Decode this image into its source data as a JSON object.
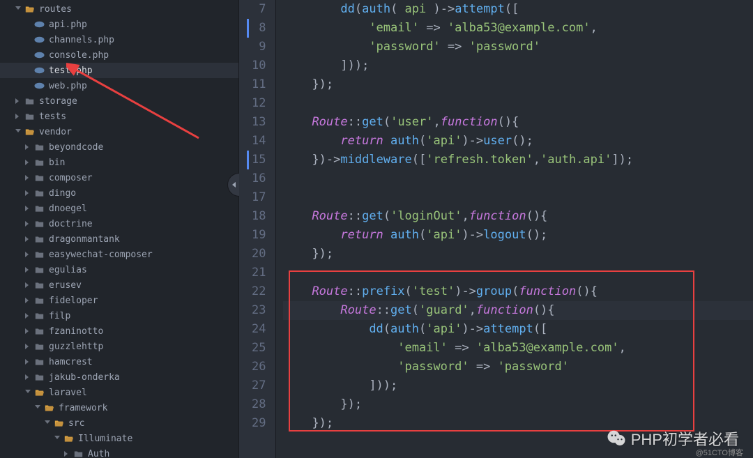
{
  "sidebar": {
    "items": [
      {
        "indent": 1,
        "kind": "folder-open",
        "arrow": "expanded",
        "label": "routes"
      },
      {
        "indent": 2,
        "kind": "php",
        "arrow": "",
        "label": "api.php"
      },
      {
        "indent": 2,
        "kind": "php",
        "arrow": "",
        "label": "channels.php"
      },
      {
        "indent": 2,
        "kind": "php",
        "arrow": "",
        "label": "console.php"
      },
      {
        "indent": 2,
        "kind": "php",
        "arrow": "",
        "label": "test.php",
        "active": true
      },
      {
        "indent": 2,
        "kind": "php",
        "arrow": "",
        "label": "web.php"
      },
      {
        "indent": 1,
        "kind": "folder",
        "arrow": "collapsed",
        "label": "storage"
      },
      {
        "indent": 1,
        "kind": "folder",
        "arrow": "collapsed",
        "label": "tests"
      },
      {
        "indent": 1,
        "kind": "folder-open",
        "arrow": "expanded",
        "label": "vendor"
      },
      {
        "indent": 2,
        "kind": "folder",
        "arrow": "collapsed",
        "label": "beyondcode"
      },
      {
        "indent": 2,
        "kind": "folder",
        "arrow": "collapsed",
        "label": "bin"
      },
      {
        "indent": 2,
        "kind": "folder",
        "arrow": "collapsed",
        "label": "composer"
      },
      {
        "indent": 2,
        "kind": "folder",
        "arrow": "collapsed",
        "label": "dingo"
      },
      {
        "indent": 2,
        "kind": "folder",
        "arrow": "collapsed",
        "label": "dnoegel"
      },
      {
        "indent": 2,
        "kind": "folder",
        "arrow": "collapsed",
        "label": "doctrine"
      },
      {
        "indent": 2,
        "kind": "folder",
        "arrow": "collapsed",
        "label": "dragonmantank"
      },
      {
        "indent": 2,
        "kind": "folder",
        "arrow": "collapsed",
        "label": "easywechat-composer"
      },
      {
        "indent": 2,
        "kind": "folder",
        "arrow": "collapsed",
        "label": "egulias"
      },
      {
        "indent": 2,
        "kind": "folder",
        "arrow": "collapsed",
        "label": "erusev"
      },
      {
        "indent": 2,
        "kind": "folder",
        "arrow": "collapsed",
        "label": "fideloper"
      },
      {
        "indent": 2,
        "kind": "folder",
        "arrow": "collapsed",
        "label": "filp"
      },
      {
        "indent": 2,
        "kind": "folder",
        "arrow": "collapsed",
        "label": "fzaninotto"
      },
      {
        "indent": 2,
        "kind": "folder",
        "arrow": "collapsed",
        "label": "guzzlehttp"
      },
      {
        "indent": 2,
        "kind": "folder",
        "arrow": "collapsed",
        "label": "hamcrest"
      },
      {
        "indent": 2,
        "kind": "folder",
        "arrow": "collapsed",
        "label": "jakub-onderka"
      },
      {
        "indent": 2,
        "kind": "folder-open",
        "arrow": "expanded",
        "label": "laravel"
      },
      {
        "indent": 3,
        "kind": "folder-open",
        "arrow": "expanded",
        "label": "framework"
      },
      {
        "indent": 4,
        "kind": "folder-open",
        "arrow": "expanded",
        "label": "src"
      },
      {
        "indent": 5,
        "kind": "folder-open",
        "arrow": "expanded",
        "label": "Illuminate"
      },
      {
        "indent": 6,
        "kind": "folder",
        "arrow": "collapsed",
        "label": "Auth"
      }
    ]
  },
  "editor": {
    "first_line_number": 7,
    "highlighted_gutter": [
      8,
      15
    ],
    "current_line": 23,
    "lines": [
      [
        [
          "",
          "        "
        ],
        [
          "fn",
          "dd"
        ],
        [
          "op",
          "("
        ],
        [
          "fn",
          "auth"
        ],
        [
          "op",
          "("
        ],
        [
          "st",
          " api "
        ],
        [
          "op",
          ")->"
        ],
        [
          "fn",
          "attempt"
        ],
        [
          "op",
          "(["
        ]
      ],
      [
        [
          "",
          "            "
        ],
        [
          "st",
          "'email'"
        ],
        [
          "op",
          " => "
        ],
        [
          "st",
          "'alba53@example.com'"
        ],
        [
          "op",
          ","
        ]
      ],
      [
        [
          "",
          "            "
        ],
        [
          "st",
          "'password'"
        ],
        [
          "op",
          " => "
        ],
        [
          "st",
          "'password'"
        ]
      ],
      [
        [
          "",
          "        "
        ],
        [
          "op",
          "]));"
        ]
      ],
      [
        [
          "",
          "    "
        ],
        [
          "op",
          "});"
        ]
      ],
      [],
      [
        [
          "",
          "    "
        ],
        [
          "k",
          "Route"
        ],
        [
          "op",
          "::"
        ],
        [
          "fn",
          "get"
        ],
        [
          "op",
          "("
        ],
        [
          "st",
          "'user'"
        ],
        [
          "op",
          ","
        ],
        [
          "kf",
          "function"
        ],
        [
          "op",
          "(){"
        ]
      ],
      [
        [
          "",
          "        "
        ],
        [
          "rt",
          "return"
        ],
        [
          "op",
          " "
        ],
        [
          "fn",
          "auth"
        ],
        [
          "op",
          "("
        ],
        [
          "st",
          "'api'"
        ],
        [
          "op",
          ")->"
        ],
        [
          "fn",
          "user"
        ],
        [
          "op",
          "();"
        ]
      ],
      [
        [
          "",
          "    "
        ],
        [
          "op",
          "})->"
        ],
        [
          "fn",
          "middleware"
        ],
        [
          "op",
          "(["
        ],
        [
          "st",
          "'refresh.token'"
        ],
        [
          "op",
          ","
        ],
        [
          "st",
          "'auth.api'"
        ],
        [
          "op",
          "]);"
        ]
      ],
      [],
      [],
      [
        [
          "",
          "    "
        ],
        [
          "k",
          "Route"
        ],
        [
          "op",
          "::"
        ],
        [
          "fn",
          "get"
        ],
        [
          "op",
          "("
        ],
        [
          "st",
          "'loginOut'"
        ],
        [
          "op",
          ","
        ],
        [
          "kf",
          "function"
        ],
        [
          "op",
          "(){"
        ]
      ],
      [
        [
          "",
          "        "
        ],
        [
          "rt",
          "return"
        ],
        [
          "op",
          " "
        ],
        [
          "fn",
          "auth"
        ],
        [
          "op",
          "("
        ],
        [
          "st",
          "'api'"
        ],
        [
          "op",
          ")->"
        ],
        [
          "fn",
          "logout"
        ],
        [
          "op",
          "();"
        ]
      ],
      [
        [
          "",
          "    "
        ],
        [
          "op",
          "});"
        ]
      ],
      [],
      [
        [
          "",
          "    "
        ],
        [
          "k",
          "Route"
        ],
        [
          "op",
          "::"
        ],
        [
          "fn",
          "prefix"
        ],
        [
          "op",
          "("
        ],
        [
          "st",
          "'test'"
        ],
        [
          "op",
          ")->"
        ],
        [
          "fn",
          "group"
        ],
        [
          "op",
          "("
        ],
        [
          "kf",
          "function"
        ],
        [
          "op",
          "(){"
        ]
      ],
      [
        [
          "",
          "        "
        ],
        [
          "k",
          "Route"
        ],
        [
          "op",
          "::"
        ],
        [
          "fn",
          "get"
        ],
        [
          "op",
          "("
        ],
        [
          "st",
          "'guard'"
        ],
        [
          "op",
          ","
        ],
        [
          "kf",
          "function"
        ],
        [
          "op",
          "(){"
        ]
      ],
      [
        [
          "",
          "            "
        ],
        [
          "fn",
          "dd"
        ],
        [
          "op",
          "("
        ],
        [
          "fn",
          "auth"
        ],
        [
          "op",
          "("
        ],
        [
          "st",
          "'api'"
        ],
        [
          "op",
          ")->"
        ],
        [
          "fn",
          "attempt"
        ],
        [
          "op",
          "(["
        ]
      ],
      [
        [
          "",
          "                "
        ],
        [
          "st",
          "'email'"
        ],
        [
          "op",
          " => "
        ],
        [
          "st",
          "'alba53@example.com'"
        ],
        [
          "op",
          ","
        ]
      ],
      [
        [
          "",
          "                "
        ],
        [
          "st",
          "'password'"
        ],
        [
          "op",
          " => "
        ],
        [
          "st",
          "'password'"
        ]
      ],
      [
        [
          "",
          "            "
        ],
        [
          "op",
          "]));"
        ]
      ],
      [
        [
          "",
          "        "
        ],
        [
          "op",
          "});"
        ]
      ],
      [
        [
          "",
          "    "
        ],
        [
          "op",
          "});"
        ]
      ]
    ]
  },
  "watermark": {
    "text": "PHP初学者必看",
    "sub": "@51CTO博客"
  }
}
